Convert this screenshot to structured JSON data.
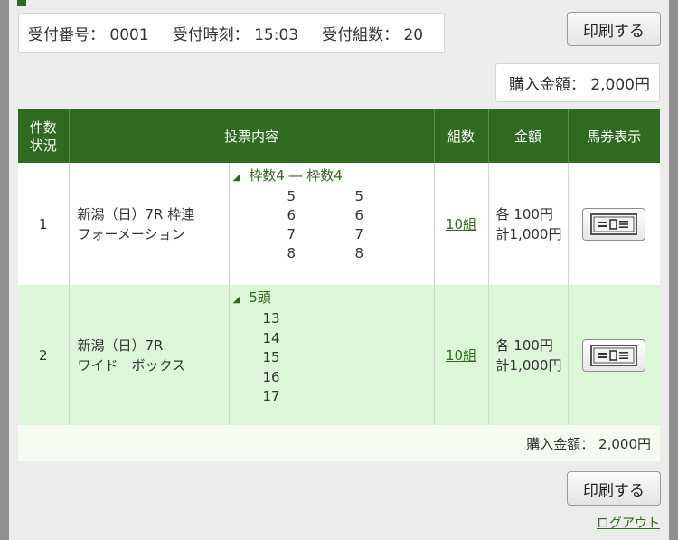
{
  "receipt": {
    "number_label": "受付番号：",
    "number": "0001",
    "time_label": "受付時刻：",
    "time": "15:03",
    "count_label": "受付組数：",
    "count": "20"
  },
  "buttons": {
    "print_label": "印刷する"
  },
  "total": {
    "label": "購入金額：",
    "value": "2,000円"
  },
  "table": {
    "headers": {
      "no_line1": "件数",
      "no_line2": "状況",
      "content": "投票内容",
      "kumi": "組数",
      "amount": "金額",
      "ticket": "馬券表示"
    },
    "rows": [
      {
        "no": "1",
        "race_line1": "新潟（日）7R 枠連",
        "race_line2": "フォーメーション",
        "bet_head": "枠数4 ― 枠数4",
        "col_a": [
          "5",
          "6",
          "7",
          "8"
        ],
        "col_b": [
          "5",
          "6",
          "7",
          "8"
        ],
        "kumi": "10組",
        "amount_each": "各 100円",
        "amount_total": "計1,000円"
      },
      {
        "no": "2",
        "race_line1": "新潟（日）7R",
        "race_line2": "ワイド　ボックス",
        "bet_head": "5頭",
        "horses": [
          "13",
          "14",
          "15",
          "16",
          "17"
        ],
        "kumi": "10組",
        "amount_each": "各 100円",
        "amount_total": "計1,000円"
      }
    ]
  },
  "footer": {
    "logout": "ログアウト"
  },
  "colors": {
    "header_green": "#2e6b1f",
    "row_highlight": "#dcf7d7"
  },
  "icons": {
    "ticket": "ticket-icon",
    "expand": "triangle-icon"
  }
}
